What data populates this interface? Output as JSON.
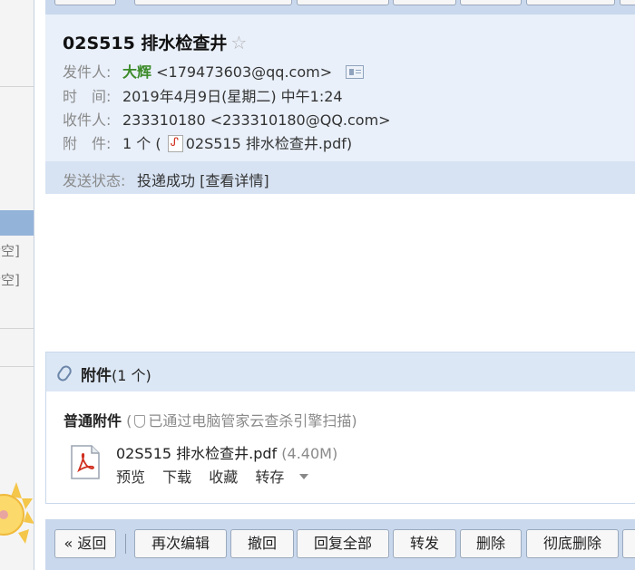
{
  "sidebar": {
    "items": [
      {
        "label": "清空"
      },
      {
        "label": "清空"
      }
    ]
  },
  "email": {
    "subject": "02S515 排水检查井",
    "star_icon": "☆",
    "from": {
      "label": "发件人:",
      "name": "大辉",
      "address": "<179473603@qq.com>"
    },
    "time": {
      "label": "时　间:",
      "value": "2019年4月9日(星期二) 中午1:24"
    },
    "to": {
      "label": "收件人:",
      "value": "233310180 <233310180@QQ.com>"
    },
    "attachments_row": {
      "label": "附　件:",
      "count": "1 个 (",
      "filename": "02S515 排水检查井.pdf",
      "close": ")"
    },
    "status": {
      "label": "发送状态:",
      "value": "投递成功",
      "link": "[查看详情]"
    }
  },
  "attachments": {
    "title": "附件",
    "count": "(1 个)",
    "section_label": "普通附件",
    "scan_note_open": "(",
    "scan_note": "已通过电脑管家云查杀引擎扫描)",
    "file": {
      "name": "02S515 排水检查井.pdf",
      "size": "(4.40M)"
    },
    "actions": {
      "preview": "预览",
      "download": "下载",
      "favorite": "收藏",
      "save_to": "转存"
    }
  },
  "toolbar": {
    "back": "« 返回",
    "edit_again": "再次编辑",
    "recall": "撤回",
    "reply_all": "回复全部",
    "forward": "转发",
    "delete": "删除",
    "delete_forever": "彻底删除"
  },
  "colors": {
    "accent": "#3d8b2a",
    "panel": "#e9f0fa",
    "toolbar": "#c9d8ec"
  }
}
